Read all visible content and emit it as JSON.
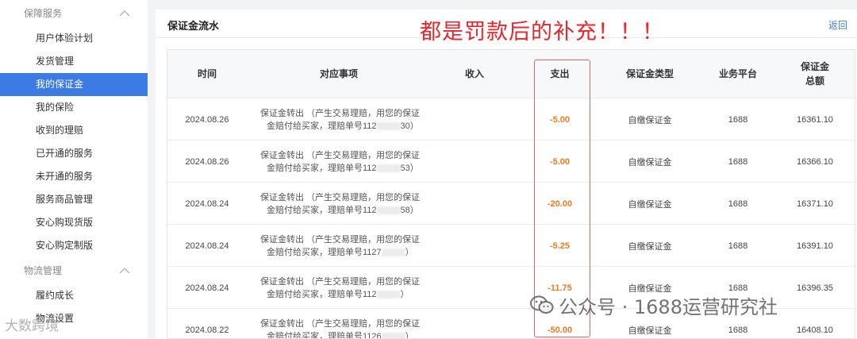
{
  "sidebar": {
    "group1_label": "保障服务",
    "items": [
      {
        "label": "用户体验计划"
      },
      {
        "label": "发货管理"
      },
      {
        "label": "我的保证金"
      },
      {
        "label": "我的保险"
      },
      {
        "label": "收到的理赔"
      },
      {
        "label": "已开通的服务"
      },
      {
        "label": "未开通的服务"
      },
      {
        "label": "服务商品管理"
      },
      {
        "label": "安心购现货版"
      },
      {
        "label": "安心购定制版"
      }
    ],
    "group2_label": "物流管理",
    "items2": [
      {
        "label": "履约成长"
      },
      {
        "label": "物流设置"
      }
    ]
  },
  "main": {
    "title": "保证金流水",
    "back_label": "返回",
    "annotation": "都是罚款后的补充！！！"
  },
  "table": {
    "headers": {
      "time": "时间",
      "item": "对应事项",
      "income": "收入",
      "expense": "支出",
      "type": "保证金类型",
      "platform": "业务平台",
      "total_line1": "保证金",
      "total_line2": "总额"
    },
    "rows": [
      {
        "time": "2024.08.26",
        "desc_line1": "保证金转出 （产生交易理赔，用您的保证",
        "desc_line2a": "金赔付给买家，理赔单号112",
        "desc_line2b": "30）",
        "income": "",
        "expense": "-5.00",
        "type": "自缴保证金",
        "platform": "1688",
        "total": "16361.10"
      },
      {
        "time": "2024.08.26",
        "desc_line1": "保证金转出 （产生交易理赔，用您的保证",
        "desc_line2a": "金赔付给买家，理赔单号112",
        "desc_line2b": "53）",
        "income": "",
        "expense": "-5.00",
        "type": "自缴保证金",
        "platform": "1688",
        "total": "16366.10"
      },
      {
        "time": "2024.08.24",
        "desc_line1": "保证金转出 （产生交易理赔，用您的保证",
        "desc_line2a": "金赔付给买家，理赔单号112",
        "desc_line2b": "58）",
        "income": "",
        "expense": "-20.00",
        "type": "自缴保证金",
        "platform": "1688",
        "total": "16371.10"
      },
      {
        "time": "2024.08.24",
        "desc_line1": "保证金转出 （产生交易理赔，用您的保证",
        "desc_line2a": "金赔付给买家，理赔单号1127",
        "desc_line2b": "）",
        "income": "",
        "expense": "-5.25",
        "type": "自缴保证金",
        "platform": "1688",
        "total": "16391.10"
      },
      {
        "time": "2024.08.24",
        "desc_line1": "保证金转出 （产生交易理赔，用您的保证",
        "desc_line2a": "金赔付给买家，理赔单号112",
        "desc_line2b": "）",
        "income": "",
        "expense": "-11.75",
        "type": "自缴保证金",
        "platform": "1688",
        "total": "16396.35"
      },
      {
        "time": "2024.08.22",
        "desc_line1": "保证金转出 （产生交易理赔，用您的保证",
        "desc_line2a": "金赔付给买家，理赔单号1126",
        "desc_line2b": "）",
        "income": "",
        "expense": "-50.00",
        "type": "自缴保证金",
        "platform": "1688",
        "total": "16408.10"
      }
    ]
  },
  "watermarks": {
    "right": "公众号 · 1688运营研究社",
    "left": "大数跨境"
  },
  "colors": {
    "active_item": "#3d7be4",
    "expense": "#f07a1d",
    "annotation": "#e8262b",
    "highlight_box": "#e06666"
  }
}
